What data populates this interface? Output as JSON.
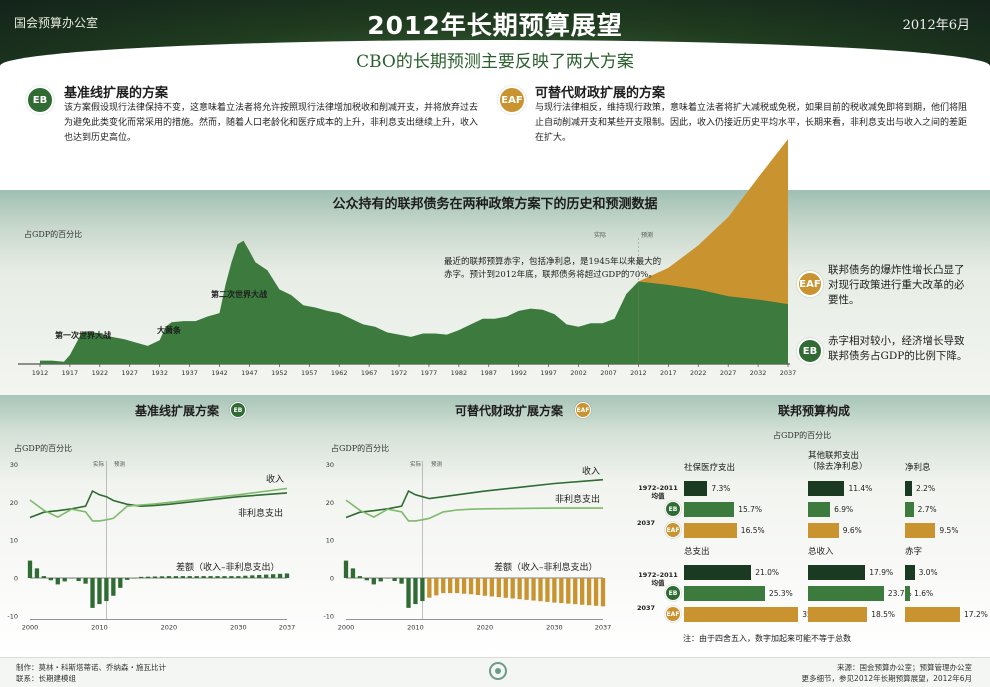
{
  "header": {
    "agency": "国会预算办公室",
    "title": "2012年长期预算展望",
    "date": "2012年6月"
  },
  "subtitle": "CBO的长期预测主要反映了两大方案",
  "scenarios": {
    "eb": {
      "badge": "EB",
      "title": "基准线扩展的方案",
      "text": "该方案假设现行法律保持不变，这意味着立法者将允许按照现行法律增加税收和削减开支，并将放弃过去为避免此类变化而常采用的措施。然而，随着人口老龄化和医疗成本的上升，非利息支出继续上升，收入也达到历史高位。"
    },
    "eaf": {
      "badge": "EAF",
      "title": "可替代财政扩展的方案",
      "text": "与现行法律相反，维持现行政策，意味着立法者将扩大减税或免税，如果目前的税收减免即将到期，他们将阻止自动削减开支和某些开支限制。因此，收入仍接近历史平均水平，长期来看，非利息支出与收入之间的差距在扩大。"
    }
  },
  "debt_chart": {
    "title": "公众持有的联邦债务在两种政策方案下的历史和预测数据",
    "unit_label": "占GDP的百分比",
    "actual_label": "实际",
    "projection_label": "预测",
    "annotations": {
      "ww1": "第一次世界大战",
      "depression": "大萧条",
      "ww2": "第二次世界大战"
    },
    "note": "最近的联邦预算赤字，包括净利息，是1945年以来最大的赤字。预计到2012年底，联邦债务将超过GDP的70%。",
    "eaf_note": "联邦债务的爆炸性增长凸显了对现行政策进行重大改革的必要性。",
    "eb_note": "赤字相对较小，经济增长导致联邦债务占GDP的比例下降。",
    "x_ticks": [
      "1912",
      "1917",
      "1922",
      "1927",
      "1932",
      "1937",
      "1942",
      "1947",
      "1952",
      "1957",
      "1962",
      "1967",
      "1972",
      "1977",
      "1982",
      "1987",
      "1992",
      "1997",
      "2002",
      "2007",
      "2012",
      "2017",
      "2022",
      "2027",
      "2032",
      "2037"
    ]
  },
  "lower": {
    "eb_title": "基准线扩展方案",
    "eaf_title": "可替代财政扩展方案",
    "budget_title": "联邦预算构成",
    "unit_label": "占GDP的百分比",
    "actual_label": "实际",
    "projection_label": "预测",
    "revenue_label": "收入",
    "spending_label": "非利息支出",
    "diff_label": "差额（收入–非利息支出）",
    "y_ticks": [
      "30",
      "20",
      "10",
      "0",
      "-10"
    ],
    "x_ticks": [
      "2000",
      "2010",
      "2020",
      "2030",
      "2037"
    ]
  },
  "budget": {
    "unit_label": "占GDP的百分比",
    "row_hist_top": "1972–2011",
    "row_hist_bottom": "均值",
    "row_proj": "2037",
    "note": "注：由于四舍五入，数字加起来可能不等于总数",
    "groups": [
      {
        "title": "社保医疗支出",
        "title2": "",
        "values": [
          "7.3%",
          "15.7%",
          "16.5%"
        ]
      },
      {
        "title": "其他联邦支出",
        "title2": "（除去净利息）",
        "values": [
          "11.4%",
          "6.9%",
          "9.6%"
        ]
      },
      {
        "title": "净利息",
        "title2": "",
        "values": [
          "2.2%",
          "2.7%",
          "9.5%"
        ]
      },
      {
        "title": "总支出",
        "title2": "",
        "values": [
          "21.0%",
          "25.3%",
          "35.7%"
        ]
      },
      {
        "title": "总收入",
        "title2": "",
        "values": [
          "17.9%",
          "23.7%",
          "18.5%"
        ]
      },
      {
        "title": "赤字",
        "title2": "",
        "values": [
          "3.0%",
          "1.6%",
          "17.2%"
        ]
      }
    ]
  },
  "footer": {
    "credits1": "制作：莫林・科斯塔蒂诺、乔纳森・施瓦比计",
    "credits2": "联系：长期建模组",
    "source1": "来源：国会预算办公室；预算管理办公室",
    "source2": "更多细节，参见2012年长期预算展望，2012年6月"
  },
  "colors": {
    "eb": "#2f6b33",
    "eaf": "#c9932f",
    "hist": "#1b3a22",
    "header": "#1f3a1f"
  },
  "chart_data": [
    {
      "type": "area",
      "title": "公众持有的联邦债务在两种政策方案下的历史和预测数据",
      "ylabel": "占GDP的百分比",
      "x": [
        1912,
        1914,
        1916,
        1917,
        1918,
        1919,
        1920,
        1922,
        1924,
        1926,
        1928,
        1930,
        1932,
        1933,
        1934,
        1936,
        1938,
        1940,
        1942,
        1943,
        1944,
        1945,
        1946,
        1947,
        1948,
        1950,
        1952,
        1954,
        1956,
        1958,
        1960,
        1962,
        1964,
        1966,
        1968,
        1970,
        1972,
        1974,
        1976,
        1978,
        1980,
        1982,
        1984,
        1986,
        1988,
        1990,
        1992,
        1994,
        1996,
        1998,
        2000,
        2002,
        2004,
        2006,
        2008,
        2010,
        2012
      ],
      "series": [
        {
          "name": "历史",
          "values": [
            3,
            3,
            2,
            8,
            18,
            28,
            29,
            27,
            24,
            22,
            19,
            16,
            21,
            33,
            37,
            38,
            38,
            42,
            45,
            70,
            90,
            106,
            109,
            100,
            90,
            83,
            66,
            61,
            52,
            50,
            47,
            45,
            40,
            35,
            33,
            28,
            26,
            24,
            27,
            27,
            26,
            30,
            35,
            40,
            40,
            42,
            47,
            49,
            48,
            44,
            35,
            33,
            36,
            36,
            40,
            62,
            73
          ]
        },
        {
          "name": "EB",
          "x": [
            2012,
            2017,
            2022,
            2027,
            2032,
            2037
          ],
          "values": [
            73,
            70,
            66,
            60,
            57,
            53
          ]
        },
        {
          "name": "EAF",
          "x": [
            2012,
            2017,
            2022,
            2027,
            2032,
            2037
          ],
          "values": [
            73,
            85,
            105,
            130,
            165,
            199
          ]
        }
      ]
    },
    {
      "type": "line",
      "name": "基准线扩展方案",
      "x": [
        2000,
        2002,
        2004,
        2006,
        2008,
        2009,
        2010,
        2011,
        2012,
        2014,
        2016,
        2018,
        2020,
        2025,
        2030,
        2037
      ],
      "series": [
        {
          "name": "收入",
          "values": [
            20.6,
            17.9,
            16.1,
            18.2,
            17.5,
            15.1,
            15.1,
            15.4,
            15.8,
            19.0,
            19.3,
            19.6,
            20.0,
            21.0,
            22.0,
            23.7
          ]
        },
        {
          "name": "非利息支出",
          "values": [
            16.0,
            17.4,
            17.8,
            18.3,
            19.0,
            23.0,
            22.0,
            21.5,
            20.5,
            19.5,
            19.0,
            19.2,
            19.5,
            20.5,
            21.5,
            22.5
          ]
        },
        {
          "name": "差额（收入–非利息支出）",
          "values": [
            4.6,
            0.5,
            -1.7,
            -0.1,
            -1.5,
            -7.9,
            -6.9,
            -6.1,
            -4.7,
            -0.5,
            0.3,
            0.4,
            0.5,
            0.5,
            0.5,
            1.2
          ]
        }
      ],
      "ylim": [
        -10,
        30
      ]
    },
    {
      "type": "line",
      "name": "可替代财政扩展方案",
      "x": [
        2000,
        2002,
        2004,
        2006,
        2008,
        2009,
        2010,
        2011,
        2012,
        2014,
        2016,
        2018,
        2020,
        2025,
        2030,
        2037
      ],
      "series": [
        {
          "name": "收入",
          "values": [
            20.6,
            17.9,
            16.1,
            18.2,
            17.5,
            15.1,
            15.1,
            15.4,
            15.8,
            17.5,
            18.0,
            18.2,
            18.3,
            18.4,
            18.5,
            18.5
          ]
        },
        {
          "name": "非利息支出",
          "values": [
            16.0,
            17.4,
            17.8,
            18.3,
            19.0,
            23.0,
            22.0,
            21.5,
            21.0,
            21.5,
            22.0,
            22.5,
            23.0,
            24.0,
            25.0,
            26.0
          ]
        },
        {
          "name": "差额（收入–非利息支出）",
          "values": [
            4.6,
            0.5,
            -1.7,
            -0.1,
            -1.5,
            -7.9,
            -6.9,
            -6.1,
            -5.2,
            -4.0,
            -4.0,
            -4.3,
            -4.7,
            -5.6,
            -6.5,
            -7.5
          ]
        }
      ],
      "ylim": [
        -10,
        30
      ]
    }
  ]
}
